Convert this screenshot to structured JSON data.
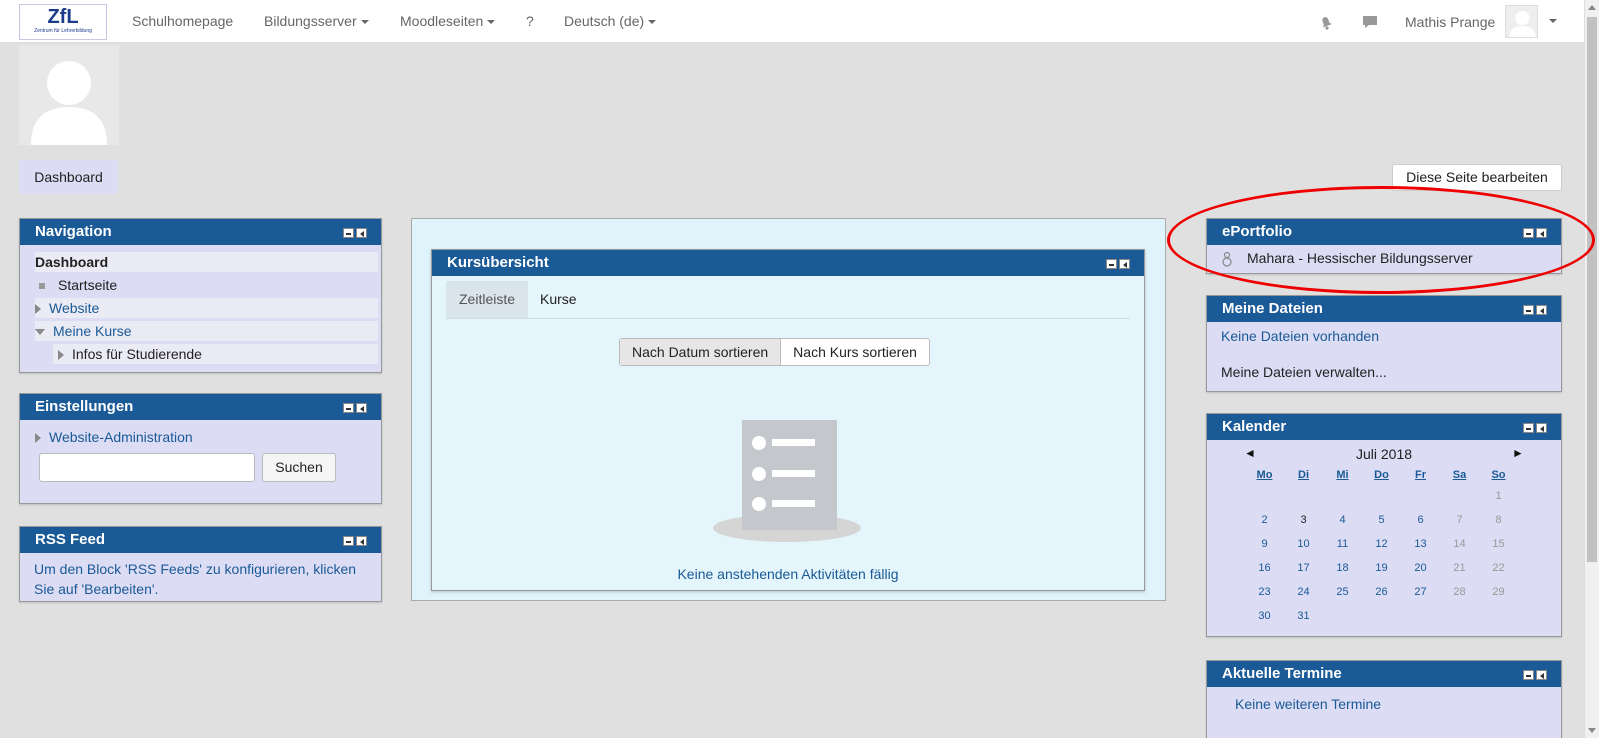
{
  "navbar": {
    "logo_text": "ZfL",
    "logo_subtext": "Zentrum für Lehrerbildung",
    "links": [
      {
        "label": "Schulhomepage",
        "has_caret": false
      },
      {
        "label": "Bildungsserver",
        "has_caret": true
      },
      {
        "label": "Moodleseiten",
        "has_caret": true
      },
      {
        "label": "?",
        "has_caret": false
      },
      {
        "label": "Deutsch (de)",
        "has_caret": true
      }
    ],
    "user_name": "Mathis Prange"
  },
  "page": {
    "dashboard_label": "Dashboard",
    "edit_page_label": "Diese Seite bearbeiten"
  },
  "navigation": {
    "title": "Navigation",
    "items": [
      {
        "label": "Dashboard"
      },
      {
        "label": "Startseite"
      },
      {
        "label": "Website"
      },
      {
        "label": "Meine Kurse"
      },
      {
        "label": "Infos für Studierende"
      }
    ]
  },
  "settings": {
    "title": "Einstellungen",
    "admin_label": "Website-Administration",
    "search_value": "",
    "search_button": "Suchen"
  },
  "rss": {
    "title": "RSS Feed",
    "text": "Um den Block 'RSS Feeds' zu konfigurieren, klicken Sie auf 'Bearbeiten'."
  },
  "kurs": {
    "title": "Kursübersicht",
    "tabs": [
      "Zeitleiste",
      "Kurse"
    ],
    "sort_date": "Nach Datum sortieren",
    "sort_course": "Nach Kurs sortieren",
    "empty_text": "Keine anstehenden Aktivitäten fällig"
  },
  "eportfolio": {
    "title": "ePortfolio",
    "link": "Mahara - Hessischer Bildungsserver"
  },
  "files": {
    "title": "Meine Dateien",
    "none": "Keine Dateien vorhanden",
    "manage": "Meine Dateien verwalten..."
  },
  "calendar": {
    "title": "Kalender",
    "month": "Juli 2018",
    "prev": "◄",
    "next": "►",
    "weekdays": [
      "Mo",
      "Di",
      "Mi",
      "Do",
      "Fr",
      "Sa",
      "So"
    ],
    "weeks": [
      [
        "",
        "",
        "",
        "",
        "",
        "",
        "1"
      ],
      [
        "2",
        "3",
        "4",
        "5",
        "6",
        "7",
        "8"
      ],
      [
        "9",
        "10",
        "11",
        "12",
        "13",
        "14",
        "15"
      ],
      [
        "16",
        "17",
        "18",
        "19",
        "20",
        "21",
        "22"
      ],
      [
        "23",
        "24",
        "25",
        "26",
        "27",
        "28",
        "29"
      ],
      [
        "30",
        "31",
        "",
        "",
        "",
        "",
        ""
      ]
    ],
    "today": "3"
  },
  "events": {
    "title": "Aktuelle Termine",
    "none": "Keine weiteren Termine"
  },
  "colors": {
    "block_header": "#1a5a96",
    "block_bg": "#dcdcf4",
    "link": "#1a5a96",
    "highlight_ellipse": "#e00000"
  }
}
